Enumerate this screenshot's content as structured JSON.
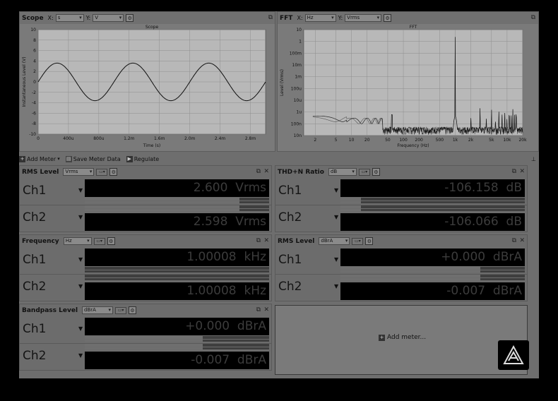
{
  "scope": {
    "title": "Scope",
    "x_label": "X:",
    "x_unit": "s",
    "y_label": "Y:",
    "y_unit": "V",
    "plot_title": "Scope",
    "y_axis_title": "Instantaneous Level (V)",
    "x_axis_title": "Time (s)",
    "y_ticks": [
      "10",
      "8",
      "6",
      "4",
      "2",
      "0",
      "-2",
      "-4",
      "-6",
      "-8",
      "-10"
    ],
    "x_ticks": [
      "0",
      "400u",
      "800u",
      "1.2m",
      "1.6m",
      "2.0m",
      "2.4m",
      "2.8m"
    ]
  },
  "fft": {
    "title": "FFT",
    "x_label": "X:",
    "x_unit": "Hz",
    "y_label": "Y:",
    "y_unit": "Vrms",
    "plot_title": "FFT",
    "y_axis_title": "Level (Vrms)",
    "x_axis_title": "Frequency (Hz)",
    "y_ticks": [
      "10",
      "1",
      "100m",
      "10m",
      "1m",
      "100u",
      "10u",
      "1u",
      "100n",
      "10n"
    ],
    "x_ticks": [
      "2",
      "5",
      "10",
      "20",
      "50",
      "100",
      "200",
      "500",
      "1k",
      "2k",
      "5k",
      "10k",
      "20k"
    ]
  },
  "toolbar": {
    "add_meter": "Add Meter",
    "save_meter_data": "Save Meter Data",
    "regulate": "Regulate"
  },
  "meters": {
    "rms_level": {
      "title": "RMS Level",
      "unit_select": "Vrms",
      "ch1_label": "Ch1",
      "ch2_label": "Ch2",
      "ch1_value": "2.600",
      "ch1_unit": "Vrms",
      "ch2_value": "2.598",
      "ch2_unit": "Vrms",
      "ch1_bar_fraction": 0.84,
      "ch2_bar_fraction": 0.84
    },
    "thdn_ratio": {
      "title": "THD+N Ratio",
      "unit_select": "dB",
      "ch1_label": "Ch1",
      "ch2_label": "Ch2",
      "ch1_value": "-106.158",
      "ch1_unit": "dB",
      "ch2_value": "-106.066",
      "ch2_unit": "dB",
      "ch1_bar_fraction": 0.11,
      "ch2_bar_fraction": 0.11
    },
    "frequency": {
      "title": "Frequency",
      "unit_select": "Hz",
      "ch1_label": "Ch1",
      "ch2_label": "Ch2",
      "ch1_value": "1.00008",
      "ch1_unit": "kHz",
      "ch2_value": "1.00008",
      "ch2_unit": "kHz",
      "ch1_bar_fraction": 0.0,
      "ch2_bar_fraction": 0.0
    },
    "rms_level_2": {
      "title": "RMS Level",
      "unit_select": "dBrA",
      "ch1_label": "Ch1",
      "ch2_label": "Ch2",
      "ch1_value": "+0.000",
      "ch1_unit": "dBrA",
      "ch2_value": "-0.007",
      "ch2_unit": "dBrA",
      "ch1_bar_fraction": 0.76,
      "ch2_bar_fraction": 0.76
    },
    "bandpass_level": {
      "title": "Bandpass Level",
      "unit_select": "dBrA",
      "ch1_label": "Ch1",
      "ch2_label": "Ch2",
      "ch1_value": "+0.000",
      "ch1_unit": "dBrA",
      "ch2_value": "-0.007",
      "ch2_unit": "dBrA",
      "ch1_bar_fraction": 0.64,
      "ch2_bar_fraction": 0.64
    }
  },
  "add_meter_panel": {
    "label": "Add meter..."
  },
  "icons": {
    "popout": "popout-icon",
    "close": "close-icon",
    "settings": "settings-icon",
    "dropdown": "chevron-down-icon"
  }
}
